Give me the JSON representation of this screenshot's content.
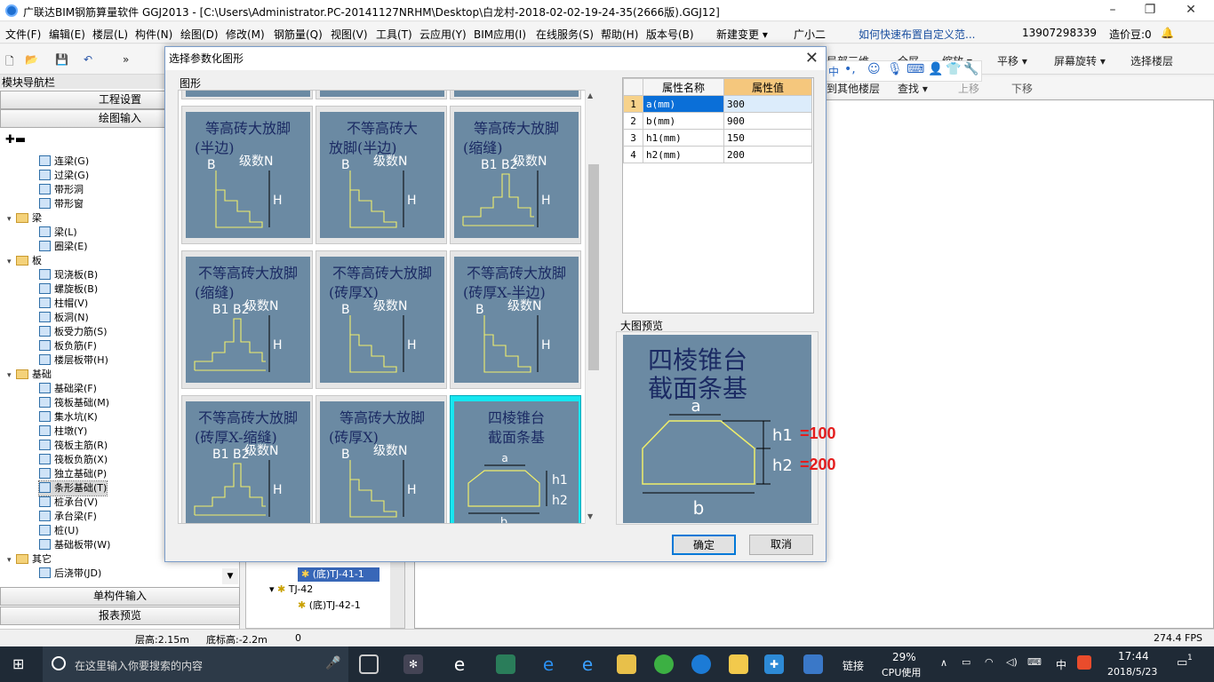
{
  "window": {
    "title": "广联达BIM钢筋算量软件 GGJ2013 - [C:\\Users\\Administrator.PC-20141127NRHM\\Desktop\\白龙村-2018-02-02-19-24-35(2666版).GGJ12]",
    "min": "–",
    "restore": "❐",
    "close": "✕"
  },
  "menu": {
    "items": [
      "文件(F)",
      "编辑(E)",
      "楼层(L)",
      "构件(N)",
      "绘图(D)",
      "修改(M)",
      "钢筋量(Q)",
      "视图(V)",
      "工具(T)",
      "云应用(Y)",
      "BIM应用(I)",
      "在线服务(S)",
      "帮助(H)",
      "版本号(B)",
      "新建变更 ▾",
      "广小二"
    ],
    "link": "如何快速布置自定义范...",
    "phone": "13907298339",
    "price": "造价豆:0"
  },
  "toolbar": {
    "items": [
      "局部三维",
      "全屏",
      "缩放 ▾",
      "平移 ▾",
      "屏幕旋转 ▾",
      "选择楼层"
    ],
    "row2": [
      "到其他楼层",
      "查找 ▾",
      "上移",
      "下移"
    ]
  },
  "nav": {
    "title": "模块导航栏",
    "project_settings": "工程设置",
    "draw_input": "绘图输入",
    "single_input": "单构件输入",
    "report_preview": "报表预览",
    "tree": [
      {
        "t": "item",
        "label": "连梁(G)",
        "lv": 2
      },
      {
        "t": "item",
        "label": "过梁(G)",
        "lv": 2
      },
      {
        "t": "item",
        "label": "带形洞",
        "lv": 2
      },
      {
        "t": "item",
        "label": "带形窗",
        "lv": 2
      },
      {
        "t": "folder",
        "label": "梁",
        "lv": 1
      },
      {
        "t": "item",
        "label": "梁(L)",
        "lv": 2
      },
      {
        "t": "item",
        "label": "圈梁(E)",
        "lv": 2
      },
      {
        "t": "folder",
        "label": "板",
        "lv": 1
      },
      {
        "t": "item",
        "label": "现浇板(B)",
        "lv": 2
      },
      {
        "t": "item",
        "label": "螺旋板(B)",
        "lv": 2
      },
      {
        "t": "item",
        "label": "柱帽(V)",
        "lv": 2
      },
      {
        "t": "item",
        "label": "板洞(N)",
        "lv": 2
      },
      {
        "t": "item",
        "label": "板受力筋(S)",
        "lv": 2
      },
      {
        "t": "item",
        "label": "板负筋(F)",
        "lv": 2
      },
      {
        "t": "item",
        "label": "楼层板带(H)",
        "lv": 2
      },
      {
        "t": "folder",
        "label": "基础",
        "lv": 1
      },
      {
        "t": "item",
        "label": "基础梁(F)",
        "lv": 2
      },
      {
        "t": "item",
        "label": "筏板基础(M)",
        "lv": 2
      },
      {
        "t": "item",
        "label": "集水坑(K)",
        "lv": 2
      },
      {
        "t": "item",
        "label": "柱墩(Y)",
        "lv": 2
      },
      {
        "t": "item",
        "label": "筏板主筋(R)",
        "lv": 2
      },
      {
        "t": "item",
        "label": "筏板负筋(X)",
        "lv": 2
      },
      {
        "t": "item",
        "label": "独立基础(P)",
        "lv": 2
      },
      {
        "t": "item",
        "label": "条形基础(T)",
        "lv": 2,
        "sel": true
      },
      {
        "t": "item",
        "label": "桩承台(V)",
        "lv": 2
      },
      {
        "t": "item",
        "label": "承台梁(F)",
        "lv": 2
      },
      {
        "t": "item",
        "label": "桩(U)",
        "lv": 2
      },
      {
        "t": "item",
        "label": "基础板带(W)",
        "lv": 2
      },
      {
        "t": "folder",
        "label": "其它",
        "lv": 1
      },
      {
        "t": "item",
        "label": "后浇带(JD)",
        "lv": 2
      }
    ]
  },
  "midtree": {
    "items": [
      "(底)TJ-41-1",
      "TJ-42",
      "(底)TJ-42-1"
    ]
  },
  "dialog": {
    "title": "选择参数化图形",
    "close": "✕",
    "group": "图形",
    "preview_label": "大图预览",
    "ok": "确定",
    "cancel": "取消",
    "prop_headers": [
      "属性名称",
      "属性值"
    ],
    "props": [
      {
        "n": "1",
        "name": "a(mm)",
        "val": "300"
      },
      {
        "n": "2",
        "name": "b(mm)",
        "val": "900"
      },
      {
        "n": "3",
        "name": "h1(mm)",
        "val": "150"
      },
      {
        "n": "4",
        "name": "h2(mm)",
        "val": "200"
      }
    ],
    "tiles": [
      {
        "l1": "等高砖大放脚",
        "l2": "(半边)",
        "b": "B",
        "n": "级数N",
        "h": "H"
      },
      {
        "l1": "不等高砖大",
        "l2": "放脚(半边)",
        "b": "B",
        "n": "级数N",
        "h": "H"
      },
      {
        "l1": "等高砖大放脚",
        "l2": "(缩缝)",
        "b": "B1  B2",
        "n": "级数N",
        "h": "H"
      },
      {
        "l1": "不等高砖大放脚",
        "l2": "(缩缝)",
        "b": "B1  B2",
        "n": "级数N",
        "h": "H"
      },
      {
        "l1": "不等高砖大放脚",
        "l2": "(砖厚X)",
        "b": "B",
        "n": "级数N",
        "h": "H"
      },
      {
        "l1": "不等高砖大放脚",
        "l2": "(砖厚X-半边)",
        "b": "B",
        "n": "级数N",
        "h": "H"
      },
      {
        "l1": "不等高砖大放脚",
        "l2": "(砖厚X-缩缝)",
        "b": "B1  B2",
        "n": "级数N",
        "h": "H"
      },
      {
        "l1": "等高砖大放脚",
        "l2": "(砖厚X)",
        "b": "B",
        "n": "级数N",
        "h": "H"
      },
      {
        "l1": "四棱锥台",
        "l2": "截面条基",
        "a": "a",
        "b": "b",
        "h1": "h1",
        "h2": "h2"
      }
    ],
    "preview": {
      "l1": "四棱锥台",
      "l2": "截面条基",
      "a": "a",
      "b": "b",
      "h1": "h1",
      "h2": "h2",
      "ann1": "=100",
      "ann2": "=200"
    }
  },
  "status": {
    "floor_h": "层高:2.15m",
    "bottom_h": "底标高:-2.2m",
    "val": "0",
    "fps": "274.4 FPS"
  },
  "taskbar": {
    "search": "在这里输入你要搜索的内容",
    "link": "链接",
    "cpu_pct": "29%",
    "cpu_label": "CPU使用",
    "lang": "中",
    "time": "17:44",
    "date": "2018/5/23",
    "notif": "1"
  },
  "colors": {
    "tile_bg": "#6b8aa3",
    "line": "#f0ee6a",
    "text": "#1b2a63",
    "accent": "#1ad8e6",
    "red": "#e41d1d"
  }
}
